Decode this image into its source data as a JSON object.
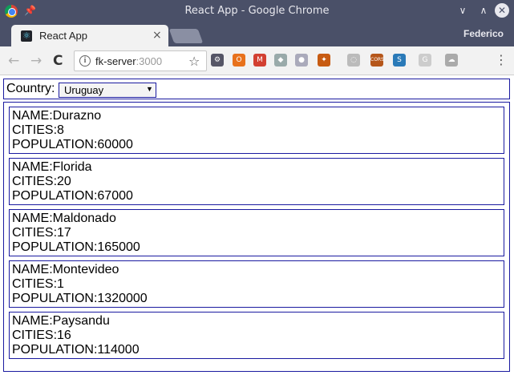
{
  "window": {
    "title": "React App - Google Chrome",
    "controls": {
      "minimize": "∨",
      "maximize": "∧",
      "close": "✕"
    }
  },
  "tabs": [
    {
      "label": "React App",
      "close": "×"
    }
  ],
  "profile_name": "Federico",
  "toolbar": {
    "back": "←",
    "forward": "→",
    "reload": "C",
    "url_host": "fk-server",
    "url_port": ":3000",
    "bookmark_star": "☆",
    "extensions": [
      {
        "name": "gear-icon",
        "glyph": "⚙",
        "color": "#556"
      },
      {
        "name": "orange-extension-icon",
        "glyph": "O",
        "color": "#e8711c"
      },
      {
        "name": "gmail-icon",
        "glyph": "M",
        "color": "#d23f31"
      },
      {
        "name": "dropbox-icon",
        "glyph": "◆",
        "color": "#9aa"
      },
      {
        "name": "circle-extension-icon",
        "glyph": "●",
        "color": "#aab"
      },
      {
        "name": "puzzle-extension-icon",
        "glyph": "✦",
        "color": "#c75b12"
      },
      {
        "name": "spinner-extension-icon",
        "glyph": "◌",
        "color": "#bbb"
      },
      {
        "name": "cors-extension-icon",
        "glyph": "CORS",
        "color": "#b5561a"
      },
      {
        "name": "s-extension-icon",
        "glyph": "S",
        "color": "#2a7ab8"
      },
      {
        "name": "g-extension-icon",
        "glyph": "G",
        "color": "#ccc"
      },
      {
        "name": "cloud-extension-icon",
        "glyph": "☁",
        "color": "#aaa"
      },
      {
        "name": "menu-icon",
        "glyph": "⋮",
        "color": "#f2f2f2"
      }
    ]
  },
  "filter": {
    "label": "Country:",
    "selected": "Uruguay"
  },
  "departments": [
    {
      "name_label": "NAME:",
      "name": "Durazno",
      "cities_label": "CITIES:",
      "cities": "8",
      "population_label": "POPULATION:",
      "population": "60000"
    },
    {
      "name_label": "NAME:",
      "name": "Florida",
      "cities_label": "CITIES:",
      "cities": "20",
      "population_label": "POPULATION:",
      "population": "67000"
    },
    {
      "name_label": "NAME:",
      "name": "Maldonado",
      "cities_label": "CITIES:",
      "cities": "17",
      "population_label": "POPULATION:",
      "population": "165000"
    },
    {
      "name_label": "NAME:",
      "name": "Montevideo",
      "cities_label": "CITIES:",
      "cities": "1",
      "population_label": "POPULATION:",
      "population": "1320000"
    },
    {
      "name_label": "NAME:",
      "name": "Paysandu",
      "cities_label": "CITIES:",
      "cities": "16",
      "population_label": "POPULATION:",
      "population": "114000"
    }
  ]
}
